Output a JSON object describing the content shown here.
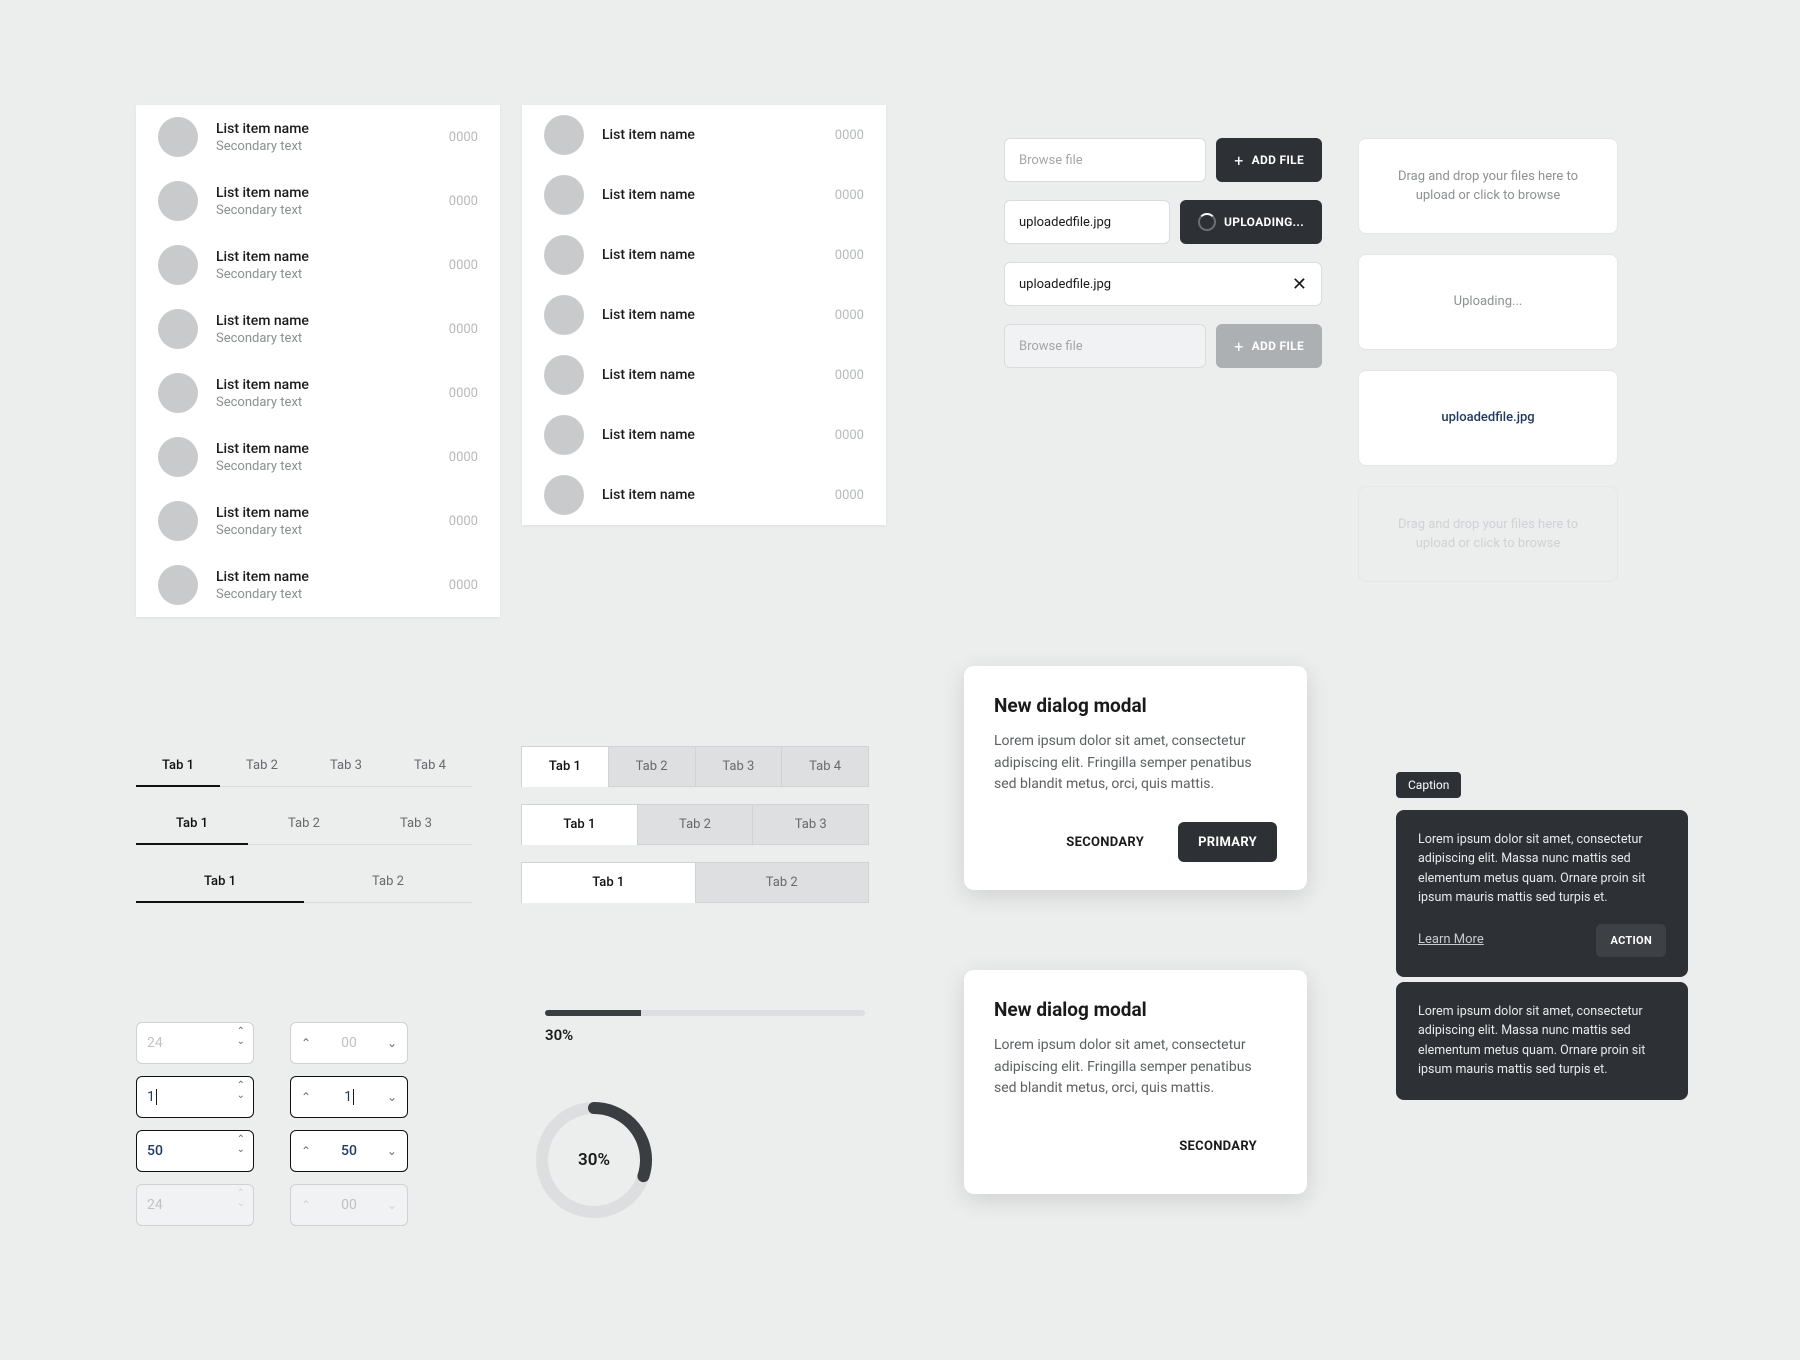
{
  "list": {
    "item_title": "List item name",
    "item_sub": "Secondary text",
    "item_num": "0000",
    "twoLineCount": 8,
    "oneLineCount": 7
  },
  "upload": {
    "browse_ph": "Browse file",
    "add_label": "ADD FILE",
    "uploading_label": "UPLOADING...",
    "filename": "uploadedfile.jpg",
    "drop_text": "Drag and drop your files here to upload or click to browse",
    "uploading_text": "Uploading..."
  },
  "tabs": {
    "t4": [
      "Tab 1",
      "Tab 2",
      "Tab 3",
      "Tab 4"
    ],
    "t3": [
      "Tab 1",
      "Tab 2",
      "Tab 3"
    ],
    "t2": [
      "Tab 1",
      "Tab 2"
    ]
  },
  "steppers": {
    "v1": "24",
    "v2": "00",
    "v3": "1",
    "v4": "1",
    "v5": "50",
    "v6": "50",
    "v7": "24",
    "v8": "00"
  },
  "progress": {
    "pct": "30%",
    "value": 30
  },
  "modal": {
    "title": "New dialog modal",
    "body": "Lorem ipsum dolor sit amet, consectetur adipiscing elit. Fringilla semper penatibus sed blandit metus, orci, quis mattis.",
    "primary": "PRIMARY",
    "secondary": "SECONDARY"
  },
  "toast": {
    "caption": "Caption",
    "body": "Lorem ipsum dolor sit amet, consectetur adipiscing elit. Massa nunc mattis sed elementum metus quam. Ornare proin sit ipsum mauris mattis sed turpis et.",
    "learn": "Learn More",
    "action": "ACTION"
  }
}
